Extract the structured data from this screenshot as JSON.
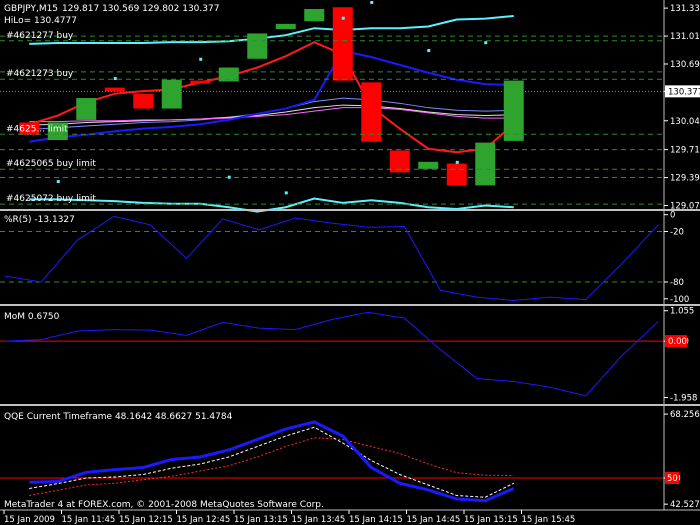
{
  "header": {
    "symbol": "GBPJPY,M15",
    "ohlc": "129.817 130.569 129.802 130.377",
    "hilo_label": "HiLo= 130.4777"
  },
  "colors": {
    "bull": "#2ea42e",
    "bear": "#ff0000",
    "band": "#5ff0ff",
    "blue_line": "#1a1aff",
    "red_line": "#ff1a1a",
    "grid": "#2e8b2e",
    "sep": "#c0c0c0",
    "price_tag_bg": "#ffffff"
  },
  "price_tag": "130.377",
  "footer": "MetaTrader 4 at FOREX.com, © 2001-2008 MetaQuotes Software Corp.",
  "order_labels": [
    {
      "text": "#4621277 buy",
      "price": 130.99
    },
    {
      "text": "#4621273 buy",
      "price": 130.55
    },
    {
      "text": "#4625... limit",
      "price": 129.92
    },
    {
      "text": "#4625065 buy limit",
      "price": 129.52
    },
    {
      "text": "#4625072 buy limit",
      "price": 129.12
    }
  ],
  "chart_data": [
    {
      "type": "candlestick",
      "symbol": "GBPJPY,M15",
      "ylim": [
        129.03,
        131.4
      ],
      "y_ticks": [
        "131.330",
        "131.010",
        "130.690",
        "130.377",
        "130.040",
        "129.710",
        "129.390",
        "129.070"
      ],
      "y_tick_values": [
        131.33,
        131.01,
        130.69,
        130.377,
        130.04,
        129.71,
        129.39,
        129.07
      ],
      "grid_levels": [
        131.01,
        130.6,
        129.71,
        129.39
      ],
      "candles": [
        {
          "o": 130.02,
          "c": 129.88
        },
        {
          "o": 129.82,
          "c": 130.02
        },
        {
          "o": 130.05,
          "c": 130.3
        },
        {
          "o": 130.42,
          "c": 130.38
        },
        {
          "o": 130.35,
          "c": 130.18
        },
        {
          "o": 130.18,
          "c": 130.51
        },
        {
          "o": 130.5,
          "c": 130.48
        },
        {
          "o": 130.49,
          "c": 130.65
        },
        {
          "o": 130.75,
          "c": 131.04
        },
        {
          "o": 131.09,
          "c": 131.15
        },
        {
          "o": 131.18,
          "c": 131.32
        },
        {
          "o": 131.34,
          "c": 130.5
        },
        {
          "o": 130.48,
          "c": 129.8
        },
        {
          "o": 129.7,
          "c": 129.45
        },
        {
          "o": 129.49,
          "c": 129.57
        },
        {
          "o": 129.55,
          "c": 129.3
        },
        {
          "o": 129.3,
          "c": 129.79
        },
        {
          "o": 129.81,
          "c": 130.5
        }
      ],
      "band_upper": [
        130.92,
        130.93,
        130.93,
        130.93,
        130.93,
        130.94,
        130.94,
        130.95,
        130.98,
        131.02,
        131.1,
        131.08,
        131.1,
        131.1,
        131.12,
        131.2,
        131.21,
        131.24
      ],
      "band_lower": [
        129.14,
        129.14,
        129.13,
        129.12,
        129.1,
        129.09,
        129.09,
        129.05,
        129.0,
        129.05,
        129.15,
        129.1,
        129.13,
        129.1,
        129.05,
        129.03,
        129.07,
        129.05
      ],
      "red_line": [
        130.0,
        130.1,
        130.25,
        130.35,
        130.38,
        130.4,
        130.48,
        130.55,
        130.65,
        130.78,
        130.94,
        130.8,
        130.2,
        129.95,
        129.72,
        129.68,
        129.72,
        130.0
      ],
      "blue_line": [
        129.8,
        129.85,
        129.88,
        129.92,
        129.95,
        129.97,
        130.0,
        130.05,
        130.12,
        130.18,
        130.28,
        130.84,
        130.77,
        130.68,
        130.59,
        130.51,
        130.46,
        130.45
      ],
      "ma_lines": [
        [
          129.94,
          129.96,
          129.98,
          130.0,
          130.02,
          130.03,
          130.05,
          130.08,
          130.12,
          130.18,
          130.26,
          130.3,
          130.28,
          130.24,
          130.19,
          130.16,
          130.15,
          130.16
        ],
        [
          129.99,
          130.0,
          130.02,
          130.03,
          130.04,
          130.05,
          130.06,
          130.08,
          130.1,
          130.14,
          130.19,
          130.22,
          130.21,
          130.18,
          130.14,
          130.11,
          130.1,
          130.11
        ],
        [
          130.03,
          130.03,
          130.04,
          130.04,
          130.05,
          130.05,
          130.06,
          130.07,
          130.09,
          130.11,
          130.15,
          130.19,
          130.19,
          130.17,
          130.13,
          130.09,
          130.07,
          130.07
        ]
      ],
      "dots": [
        [
          129.35,
          1
        ],
        [
          130.53,
          3
        ],
        [
          130.75,
          6
        ],
        [
          129.4,
          7
        ],
        [
          129.22,
          9
        ],
        [
          131.22,
          11
        ],
        [
          131.4,
          12
        ],
        [
          130.85,
          14
        ],
        [
          129.57,
          15
        ],
        [
          130.94,
          16
        ]
      ]
    },
    {
      "type": "line",
      "title": "%R(5) -13.1327",
      "ylim": [
        -105,
        2
      ],
      "y_ticks": [
        "0",
        "-20",
        "-80",
        "-100"
      ],
      "y_tick_values": [
        0,
        -20,
        -80,
        -100
      ],
      "grid_levels": [
        -20,
        -80
      ],
      "values": [
        -73,
        -80,
        -30,
        -2,
        -12,
        -52,
        -5,
        -18,
        -4,
        -10,
        -15,
        -14,
        -90,
        -98,
        -102,
        -98,
        -101,
        -58,
        -12
      ]
    },
    {
      "type": "line",
      "title": "MoM 0.6750",
      "ylim": [
        -2.15,
        1.15
      ],
      "y_ticks": [
        "1.055",
        "0.00",
        "-1.958"
      ],
      "y_tick_values": [
        1.055,
        0.0,
        -1.958
      ],
      "zero_tag": "0.00",
      "values": [
        0.0,
        0.05,
        0.35,
        0.4,
        0.38,
        0.2,
        0.65,
        0.45,
        0.4,
        0.75,
        1.0,
        0.8,
        -0.3,
        -1.3,
        -1.4,
        -1.6,
        -1.9,
        -0.5,
        0.68
      ]
    },
    {
      "type": "line",
      "title": "QQE Current Timeframe 48.1642 48.6627 51.4784",
      "ylim": [
        42.0,
        70.0
      ],
      "y_ticks": [
        "68.2561",
        "50",
        "42.5279"
      ],
      "y_tick_values": [
        68.2561,
        50,
        42.5279
      ],
      "level_tag": "50",
      "rsi_ma": [
        48.8,
        49.0,
        51.6,
        52.4,
        53.0,
        55.3,
        56.0,
        58.0,
        61.0,
        64.0,
        66.0,
        62.0,
        53.0,
        48.5,
        46.6,
        44.0,
        43.5,
        47.0
      ],
      "qqe_fast": [
        47.0,
        48.4,
        50.0,
        50.3,
        51.0,
        52.8,
        54.0,
        56.0,
        59.0,
        62.0,
        64.5,
        60.0,
        55.0,
        51.0,
        48.0,
        45.0,
        44.5,
        48.5
      ],
      "qqe_slow": [
        45.0,
        46.5,
        48.0,
        48.5,
        49.5,
        50.5,
        52.0,
        53.5,
        56.0,
        59.0,
        61.5,
        61.0,
        59.0,
        57.0,
        54.0,
        51.5,
        50.8,
        50.7
      ]
    }
  ],
  "x_labels": [
    "15 Jan 2009",
    "15 Jan 11:45",
    "15 Jan 12:15",
    "15 Jan 12:45",
    "15 Jan 13:15",
    "15 Jan 13:45",
    "15 Jan 14:15",
    "15 Jan 14:45",
    "15 Jan 15:15",
    "15 Jan 15:45"
  ]
}
